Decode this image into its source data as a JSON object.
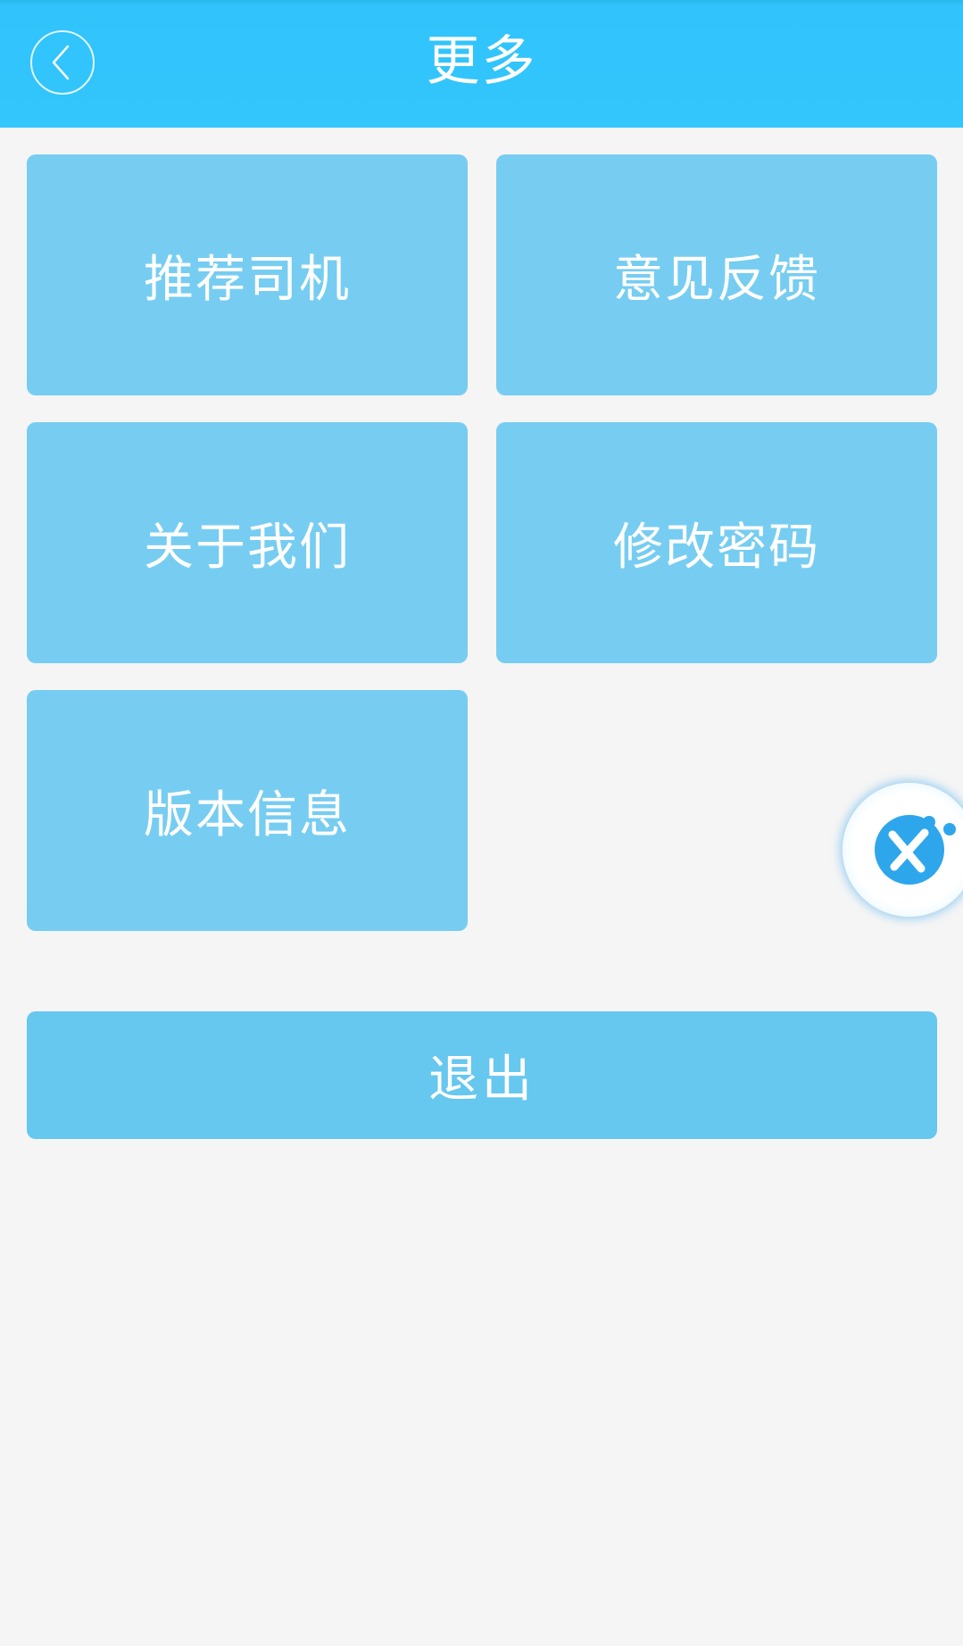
{
  "header": {
    "title": "更多",
    "back_icon": "chevron-left-icon"
  },
  "menu": {
    "items": [
      {
        "label": "推荐司机"
      },
      {
        "label": "意见反馈"
      },
      {
        "label": "关于我们"
      },
      {
        "label": "修改密码"
      },
      {
        "label": "版本信息"
      }
    ],
    "logout_label": "退出"
  },
  "floating_button": {
    "icon": "tools-icon"
  },
  "colors": {
    "header_bg": "#33c6fd",
    "tile_bg": "#77cdf1",
    "logout_bg": "#66c7ef",
    "page_bg": "#f5f5f5",
    "floating_icon": "#2ea6ec"
  }
}
